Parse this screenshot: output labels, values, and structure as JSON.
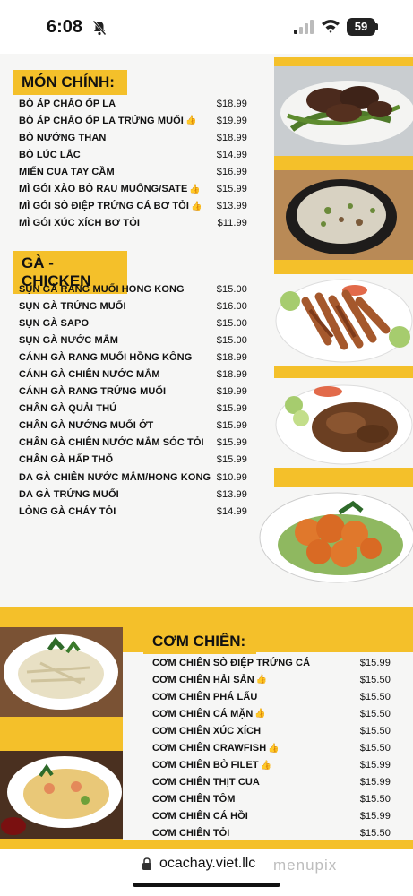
{
  "status": {
    "time": "6:08",
    "battery": "59"
  },
  "sections": {
    "main": {
      "title": "MÓN CHÍNH:",
      "items": [
        {
          "name": "BÒ ÁP CHẢO ỐP LA",
          "price": "$18.99",
          "thumb": false
        },
        {
          "name": "BÒ ÁP CHẢO ỐP LA TRỨNG MUỐI",
          "price": "$19.99",
          "thumb": true
        },
        {
          "name": "BÒ NƯỚNG THAN",
          "price": "$18.99",
          "thumb": false
        },
        {
          "name": "BÒ LÚC LẮC",
          "price": "$14.99",
          "thumb": false
        },
        {
          "name": "MIẾN CUA TAY CẦM",
          "price": "$16.99",
          "thumb": false
        },
        {
          "name": "MÌ GÓI XÀO BÒ RAU MUỐNG/SATE",
          "price": "$15.99",
          "thumb": true
        },
        {
          "name": "MÌ GÓI SÒ ĐIỆP TRỨNG CÁ BƠ TỎI",
          "price": "$13.99",
          "thumb": true
        },
        {
          "name": "MÌ GÓI XÚC XÍCH BƠ TỎI",
          "price": "$11.99",
          "thumb": false
        }
      ]
    },
    "chicken": {
      "title": "GÀ - CHICKEN",
      "items": [
        {
          "name": "SỤN GÀ RANG MUỐI HONG KONG",
          "price": "$15.00",
          "thumb": false
        },
        {
          "name": "SỤN GÀ TRỨNG MUỐI",
          "price": "$16.00",
          "thumb": false
        },
        {
          "name": "SỤN GÀ SAPO",
          "price": "$15.00",
          "thumb": false
        },
        {
          "name": "SỤN GÀ NƯỚC MẮM",
          "price": "$15.00",
          "thumb": false
        },
        {
          "name": "CÁNH GÀ RANG MUỐI HỒNG KÔNG",
          "price": "$18.99",
          "thumb": false
        },
        {
          "name": "CÁNH GÀ CHIÊN NƯỚC MẮM",
          "price": "$18.99",
          "thumb": false
        },
        {
          "name": "CÁNH GÀ RANG TRỨNG MUỐI",
          "price": "$19.99",
          "thumb": false
        },
        {
          "name": "CHÂN GÀ QUẢI THÚ",
          "price": "$15.99",
          "thumb": false
        },
        {
          "name": "CHÂN GÀ NƯỚNG MUỐI ỚT",
          "price": "$15.99",
          "thumb": false
        },
        {
          "name": "CHÂN GÀ CHIÊN NƯỚC MẮM SÓC TỎI",
          "price": "$15.99",
          "thumb": false
        },
        {
          "name": "CHÂN GÀ HẤP THỐ",
          "price": "$15.99",
          "thumb": false
        },
        {
          "name": "DA GÀ CHIÊN NƯỚC MẮM/HONG KONG",
          "price": "$10.99",
          "thumb": false
        },
        {
          "name": "DA GÀ TRỨNG MUỐI",
          "price": "$13.99",
          "thumb": false
        },
        {
          "name": "LÒNG GÀ CHÁY TỎI",
          "price": "$14.99",
          "thumb": false
        }
      ]
    },
    "rice": {
      "title": "CƠM CHIÊN:",
      "items": [
        {
          "name": "CƠM CHIÊN SÒ ĐIỆP TRỨNG CÁ",
          "price": "$15.99",
          "thumb": false
        },
        {
          "name": "CƠM CHIÊN HẢI SẢN",
          "price": "$15.50",
          "thumb": true
        },
        {
          "name": "CƠM CHIÊN PHÁ LẤU",
          "price": "$15.50",
          "thumb": false
        },
        {
          "name": "CƠM CHIÊN CÁ MẶN",
          "price": "$15.50",
          "thumb": true
        },
        {
          "name": "CƠM CHIÊN XÚC XÍCH",
          "price": "$15.50",
          "thumb": false
        },
        {
          "name": "CƠM CHIÊN CRAWFISH",
          "price": "$15.50",
          "thumb": true
        },
        {
          "name": "CƠM CHIÊN BÒ FILET",
          "price": "$15.99",
          "thumb": true
        },
        {
          "name": "CƠM CHIÊN THỊT CUA",
          "price": "$15.99",
          "thumb": false
        },
        {
          "name": "CƠM CHIÊN TÔM",
          "price": "$15.50",
          "thumb": false
        },
        {
          "name": "CƠM CHIÊN CÁ HỒI",
          "price": "$15.99",
          "thumb": false
        },
        {
          "name": "CƠM CHIÊN TỎI",
          "price": "$15.50",
          "thumb": false
        }
      ]
    }
  },
  "browser": {
    "url": "ocachay.viet.llc",
    "watermark": "menupix"
  },
  "colors": {
    "accent": "#f4c02a",
    "text": "#111111",
    "thumb": "#e8b830"
  },
  "icons": [
    "bell-slash-icon",
    "signal-icon",
    "wifi-icon",
    "battery-icon",
    "lock-icon",
    "thumbs-up-icon"
  ]
}
